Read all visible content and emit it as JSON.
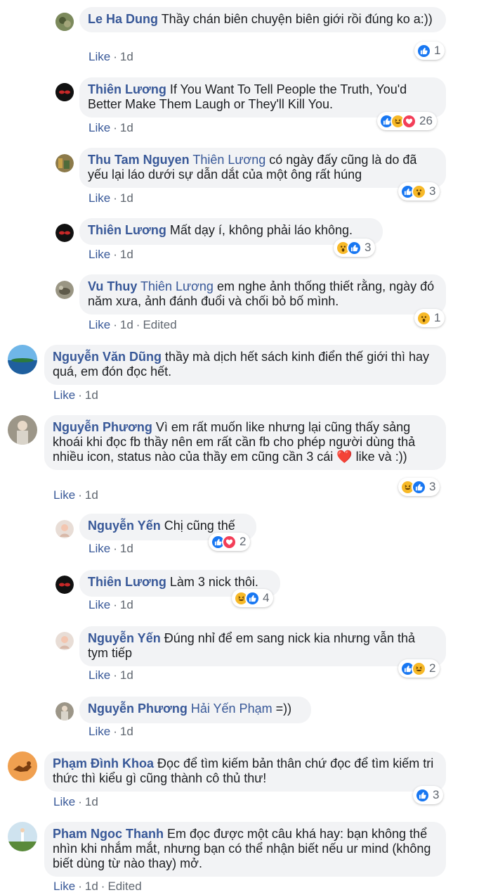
{
  "comments": [
    {
      "author": "Le Ha Dung",
      "mention": "",
      "text": " Thầy chán biên chuyện biên giới rồi đúng ko a:))",
      "like": "Like",
      "time": "1d",
      "edited": "",
      "count": "1"
    },
    {
      "author": "Thiên Lương",
      "mention": "",
      "text": " If You Want To Tell People the Truth, You'd Better Make Them Laugh or They'll Kill You.",
      "like": "Like",
      "time": "1d",
      "edited": "",
      "count": "26"
    },
    {
      "author": "Thu Tam Nguyen",
      "mention": " Thiên Lương",
      "text": " có ngày đấy cũng là do đã yếu lại láo dưới sự dẫn dắt của một ông rất húng",
      "like": "Like",
      "time": "1d",
      "edited": "",
      "count": "3"
    },
    {
      "author": "Thiên Lương",
      "mention": "",
      "text": " Mất dạy í, không phải láo không.",
      "like": "Like",
      "time": "1d",
      "edited": "",
      "count": "3"
    },
    {
      "author": "Vu Thuy",
      "mention": " Thiên Lương",
      "text": " em nghe ảnh thống thiết rằng, ngày đó năm xưa, ảnh đánh đuổi và chối bỏ bố mình.",
      "like": "Like",
      "time": "1d",
      "edited": "Edited",
      "count": "1"
    },
    {
      "author": "Nguyễn Văn Dũng",
      "mention": "",
      "text": " thầy mà dịch hết sách kinh điển thế giới thì hay quá, em đón đọc hết.",
      "like": "Like",
      "time": "1d",
      "edited": "",
      "count": ""
    },
    {
      "author": "Nguyễn Phương",
      "mention": "",
      "text": " Vì em rất muốn like nhưng lại cũng thấy sảng khoái khi đọc fb thầy nên em rất cần fb cho phép người dùng thả nhiều icon, status nào của thầy em cũng cần 3 cái ❤️ like và :))",
      "like": "Like",
      "time": "1d",
      "edited": "",
      "count": "3"
    },
    {
      "author": "Nguyễn Yến",
      "mention": "",
      "text": " Chị cũng thế",
      "like": "Like",
      "time": "1d",
      "edited": "",
      "count": "2"
    },
    {
      "author": "Thiên Lương",
      "mention": "",
      "text": " Làm 3 nick thôi.",
      "like": "Like",
      "time": "1d",
      "edited": "",
      "count": "4"
    },
    {
      "author": "Nguyễn Yến",
      "mention": "",
      "text": " Đúng nhỉ để em sang nick kia nhưng vẫn thả tym tiếp",
      "like": "Like",
      "time": "1d",
      "edited": "",
      "count": "2"
    },
    {
      "author": "Nguyễn Phương",
      "mention": " Hải Yến Phạm",
      "text": " =))",
      "like": "Like",
      "time": "1d",
      "edited": "",
      "count": ""
    },
    {
      "author": "Phạm Đình Khoa",
      "mention": "",
      "text": " Đọc để tìm kiếm bản thân chứ đọc để tìm kiếm tri thức thì kiểu gì cũng thành cô thủ thư!",
      "like": "Like",
      "time": "1d",
      "edited": "",
      "count": "3"
    },
    {
      "author": "Pham Ngoc Thanh",
      "mention": "",
      "text": " Em đọc được một câu khá hay: bạn không thể nhìn khi nhắm mắt, nhưng bạn có thể nhận biết nếu ur mind (không biết dùng từ nào thay) mở.",
      "like": "Like",
      "time": "1d",
      "edited": "Edited",
      "count": ""
    }
  ],
  "colors": {
    "link": "#385898",
    "bubble": "#f2f3f5",
    "meta": "#606770",
    "like": "#1877f2",
    "haha": "#f7b928",
    "love": "#f33e58"
  }
}
